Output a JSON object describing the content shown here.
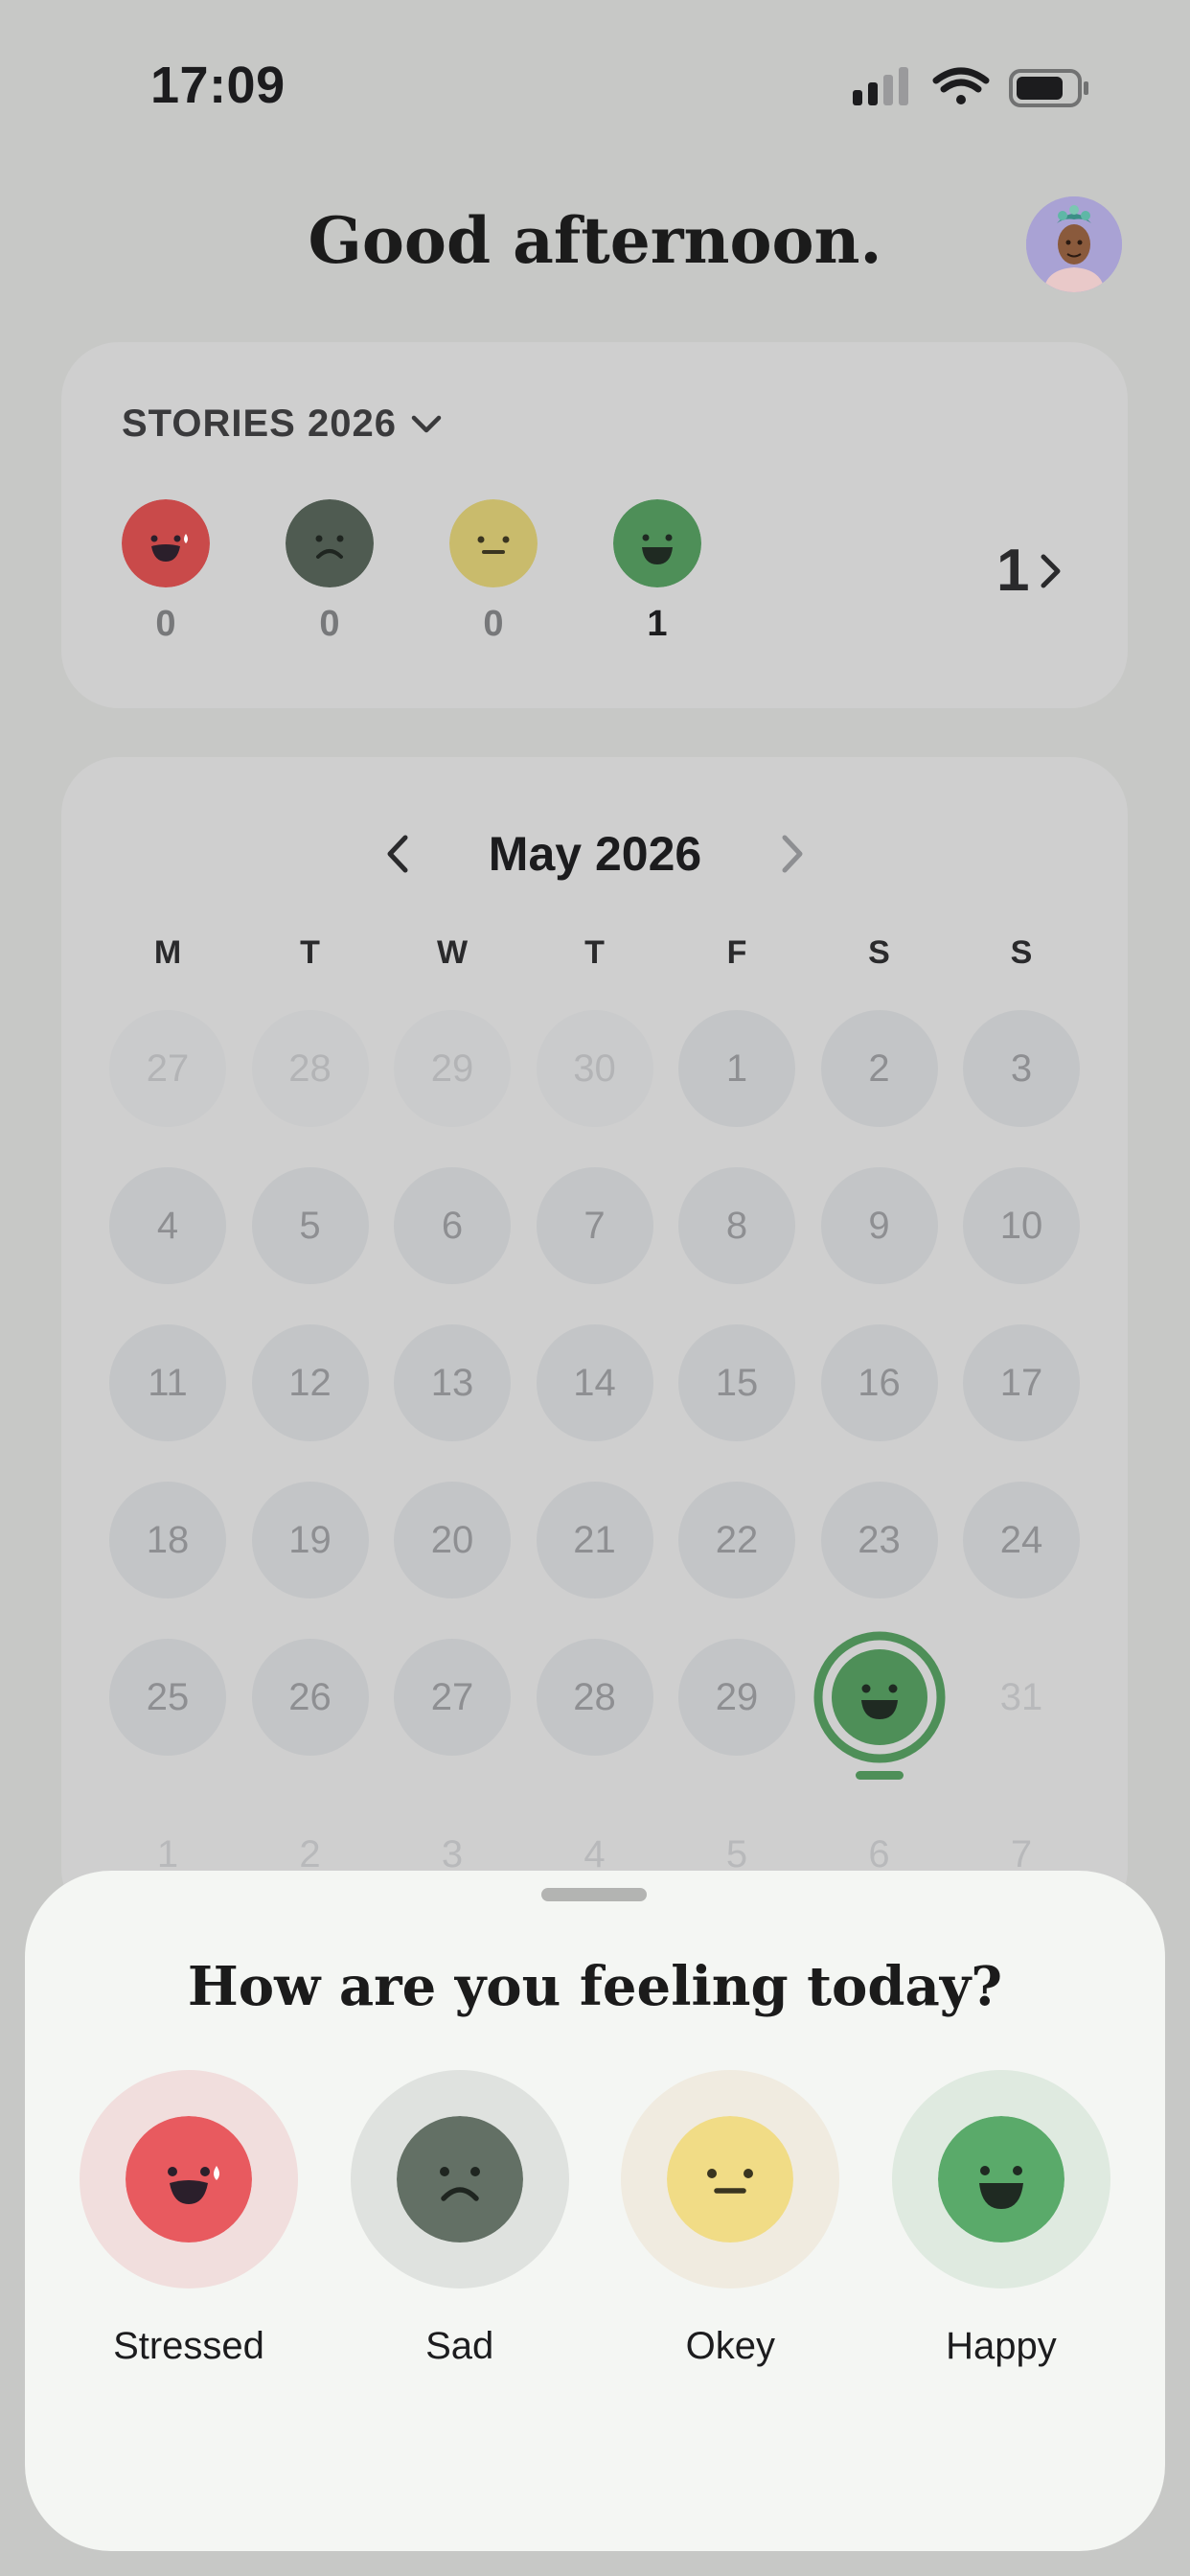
{
  "status_bar": {
    "time": "17:09"
  },
  "header": {
    "greeting": "Good afternoon."
  },
  "stories": {
    "title": "STORIES 2026",
    "moods": [
      {
        "name": "stressed",
        "count": "0",
        "color": "#c94a4a"
      },
      {
        "name": "sad",
        "count": "0",
        "color": "#4f5b51"
      },
      {
        "name": "okey",
        "count": "0",
        "color": "#c9bb6c"
      },
      {
        "name": "happy",
        "count": "1",
        "color": "#4e8f58"
      }
    ],
    "total": "1"
  },
  "calendar": {
    "month": "May 2026",
    "weekdays": [
      "M",
      "T",
      "W",
      "T",
      "F",
      "S",
      "S"
    ],
    "days": [
      "27",
      "28",
      "29",
      "30",
      "1",
      "2",
      "3",
      "4",
      "5",
      "6",
      "7",
      "8",
      "9",
      "10",
      "11",
      "12",
      "13",
      "14",
      "15",
      "16",
      "17",
      "18",
      "19",
      "20",
      "21",
      "22",
      "23",
      "24",
      "25",
      "26",
      "27",
      "28",
      "29",
      "",
      "31",
      "1",
      "2",
      "3",
      "4",
      "5",
      "6",
      "7"
    ],
    "selected_mood": "happy"
  },
  "sheet": {
    "question": "How are you feeling today?",
    "options": [
      {
        "label": "Stressed",
        "face_color": "#e85a5f",
        "halo_color": "#f1dedd"
      },
      {
        "label": "Sad",
        "face_color": "#637065",
        "halo_color": "#dfe2df"
      },
      {
        "label": "Okey",
        "face_color": "#f1dc86",
        "halo_color": "#f0ebe0"
      },
      {
        "label": "Happy",
        "face_color": "#5aaa6a",
        "halo_color": "#dfeae0"
      }
    ]
  }
}
